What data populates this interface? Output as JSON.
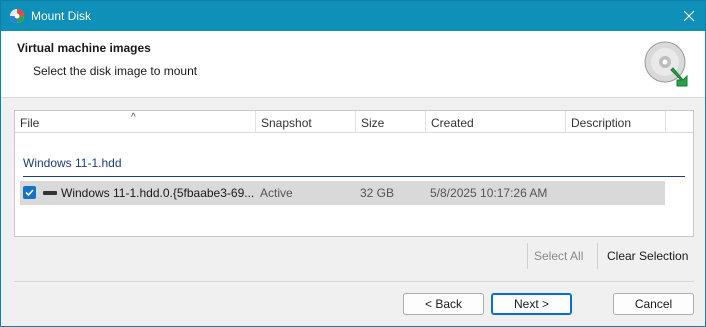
{
  "window": {
    "title": "Mount Disk"
  },
  "header": {
    "title": "Virtual machine images",
    "subtitle": "Select the disk image to mount"
  },
  "table": {
    "columns": [
      "File",
      "Snapshot",
      "Size",
      "Created",
      "Description"
    ],
    "sort_indicator": "^",
    "group": "Windows 11-1.hdd",
    "rows": [
      {
        "file": "Windows 11-1.hdd.0.{5fbaabe3-69...",
        "snapshot": "Active",
        "size": "32 GB",
        "created": "5/8/2025 10:17:26 AM",
        "description": "",
        "checked": true
      }
    ]
  },
  "actions": {
    "select_all": "Select All",
    "clear_selection": "Clear Selection"
  },
  "footer": {
    "back": "< Back",
    "next": "Next >",
    "cancel": "Cancel"
  },
  "colors": {
    "titlebar": "#0e90b8",
    "group_text": "#1f3f7a",
    "checkbox": "#1672c6"
  }
}
